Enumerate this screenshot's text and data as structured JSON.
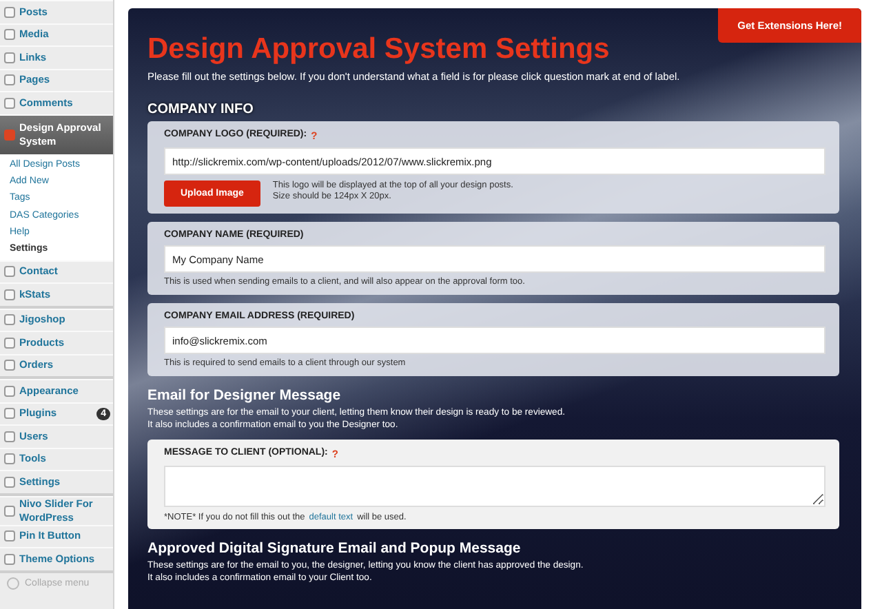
{
  "sidebar": {
    "groups": [
      {
        "items": [
          {
            "label": "Posts",
            "selected": false
          },
          {
            "label": "Media",
            "selected": false
          },
          {
            "label": "Links",
            "selected": false
          },
          {
            "label": "Pages",
            "selected": false
          },
          {
            "label": "Comments",
            "selected": false
          },
          {
            "label": "Design Approval System",
            "selected": true,
            "children": [
              {
                "label": "All Design Posts",
                "selected": false
              },
              {
                "label": "Add New",
                "selected": false
              },
              {
                "label": "Tags",
                "selected": false
              },
              {
                "label": "DAS Categories",
                "selected": false
              },
              {
                "label": "Help",
                "selected": false
              },
              {
                "label": "Settings",
                "selected": true
              }
            ]
          },
          {
            "label": "Contact",
            "selected": false
          },
          {
            "label": "kStats",
            "selected": false
          }
        ]
      },
      {
        "items": [
          {
            "label": "Jigoshop",
            "selected": false
          },
          {
            "label": "Products",
            "selected": false
          },
          {
            "label": "Orders",
            "selected": false
          }
        ]
      },
      {
        "items": [
          {
            "label": "Appearance",
            "selected": false
          },
          {
            "label": "Plugins",
            "selected": false,
            "badge": "4"
          },
          {
            "label": "Users",
            "selected": false
          },
          {
            "label": "Tools",
            "selected": false
          },
          {
            "label": "Settings",
            "selected": false
          }
        ]
      },
      {
        "items": [
          {
            "label": "Nivo Slider For WordPress",
            "selected": false
          },
          {
            "label": "Pin It Button",
            "selected": false
          },
          {
            "label": "Theme Options",
            "selected": false
          }
        ]
      }
    ],
    "collapse": "Collapse menu"
  },
  "header": {
    "button": "Get Extensions Here!",
    "title": "Design Approval System Settings",
    "subtitle": "Please fill out the settings below. If you don't understand what a field is for please click question mark at end of label."
  },
  "sections": [
    {
      "title": "COMPANY INFO",
      "kind": "caps",
      "cards": [
        {
          "label": "COMPANY LOGO (REQUIRED):",
          "help_mark": "?",
          "kind": "text",
          "value": "http://slickremix.com/wp-content/uploads/2012/07/www.slickremix.png",
          "button": "Upload Image",
          "help": [
            "This logo will be displayed at the top of all your design posts.",
            "Size should be 124px X 20px."
          ]
        },
        {
          "label": "COMPANY NAME (REQUIRED)",
          "kind": "text",
          "value": "My Company Name",
          "help": [
            "This is used when sending emails to a client, and will also appear on the approval form too."
          ]
        },
        {
          "label": "COMPANY EMAIL ADDRESS (REQUIRED)",
          "kind": "text",
          "value": "info@slickremix.com",
          "help": [
            "This is required to send emails to a client through our system"
          ]
        }
      ]
    },
    {
      "title": "Email for Designer Message",
      "kind": "plain",
      "lines": [
        "These settings are for the email to your client, letting them know their design is ready to be reviewed.",
        "It also includes a confirmation email to you the Designer too."
      ],
      "cards": [
        {
          "label": "MESSAGE TO CLIENT (OPTIONAL):",
          "help_mark": "?",
          "kind": "textarea",
          "note": {
            "before": "*NOTE* If you do not fill this out the",
            "link": "default text",
            "after": "will be used."
          }
        }
      ]
    },
    {
      "title": "Approved Digital Signature Email and Popup Message",
      "kind": "plain",
      "lines": [
        "These settings are for the email to you, the designer, letting you know the client has approved the design.",
        "It also includes a confirmation email to your Client too."
      ]
    }
  ]
}
